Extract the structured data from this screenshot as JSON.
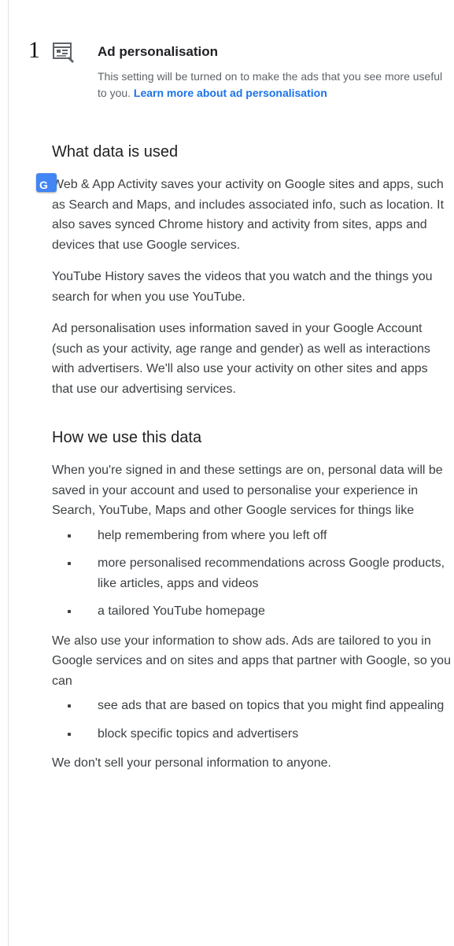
{
  "step": {
    "number": "1"
  },
  "setting": {
    "icon": "ad-window-icon",
    "title": "Ad personalisation",
    "description": "This setting will be turned on to make the ads that you see more useful to you. ",
    "link_label": "Learn more about ad personalisation"
  },
  "what_data": {
    "heading": "What data is used",
    "translate_icon": "google-translate-icon",
    "paragraphs": [
      "Web & App Activity saves your activity on Google sites and apps, such as Search and Maps, and includes associated info, such as location. It also saves synced Chrome history and activity from sites, apps and devices that use Google services.",
      "YouTube History saves the videos that you watch and the things you search for when you use YouTube.",
      "Ad personalisation uses information saved in your Google Account (such as your activity, age range and gender) as well as interactions with advertisers. We'll also use your activity on other sites and apps that use our advertising services."
    ]
  },
  "how_data": {
    "heading": "How we use this data",
    "intro": "When you're signed in and these settings are on, personal data will be saved in your account and used to personalise your experience in Search, YouTube, Maps and other Google services for things like",
    "bullets": [
      "help remembering from where you left off",
      "more personalised recommendations across Google products, like articles, apps and videos",
      "a tailored YouTube homepage"
    ],
    "ads_intro": "We also use your information to show ads. Ads are tailored to you in Google services and on sites and apps that partner with Google, so you can",
    "ads_bullets": [
      "see ads that are based on topics that you might find appealing",
      "block specific topics and advertisers"
    ],
    "closing": "We don't sell your personal information to anyone."
  },
  "colors": {
    "link": "#1a73e8",
    "body_text": "#3c4043",
    "muted": "#5f6368"
  }
}
